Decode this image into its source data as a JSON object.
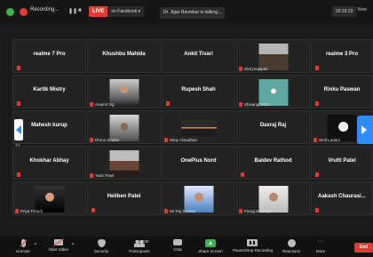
{
  "topbar": {
    "recording_label": "Recording...",
    "live_badge": "LIVE",
    "live_target": "on Facebook ▾",
    "talking": "Dr. Jigar Ravrekar is talking...",
    "timer": "00:16:23",
    "view": "View"
  },
  "tiles": [
    {
      "name": "realme 7 Pro",
      "label": ""
    },
    {
      "name": "Khushbu Mahida",
      "label": ""
    },
    {
      "name": "Ankit Tivari",
      "label": ""
    },
    {
      "name": "",
      "label": "dixit prajapati"
    },
    {
      "name": "realme 3 Pro",
      "label": ""
    },
    {
      "name": "Kartik Mistry",
      "label": ""
    },
    {
      "name": "",
      "label": "Anamit Vig"
    },
    {
      "name": "Rupesh Shah",
      "label": ""
    },
    {
      "name": "",
      "label": "Shivangi Patel"
    },
    {
      "name": "Rinku Paswan",
      "label": ""
    },
    {
      "name": "Mahesh kurup",
      "label": ""
    },
    {
      "name": "",
      "label": "Dhruv Shukla"
    },
    {
      "name": "",
      "label": "Nilay chaudhari"
    },
    {
      "name": "Daxraj Raj",
      "label": ""
    },
    {
      "name": "",
      "label": "Smit Ladani"
    },
    {
      "name": "Khokhar Abhay",
      "label": ""
    },
    {
      "name": "",
      "label": "Yash Patel"
    },
    {
      "name": "OnePlus Nord",
      "label": ""
    },
    {
      "name": "Baldev Rathod",
      "label": ""
    },
    {
      "name": "Vrutti Patel",
      "label": ""
    },
    {
      "name": "",
      "label": "Priya Trivedi"
    },
    {
      "name": "Heliben Patel",
      "label": ""
    },
    {
      "name": "",
      "label": "Mr Raj D Patel"
    },
    {
      "name": "",
      "label": "Parag Babariya"
    },
    {
      "name": "Aakash Chaurasi...",
      "label": ""
    }
  ],
  "nav": {
    "page": "1/4"
  },
  "toolbar": {
    "unmute": "Unmute",
    "start_video": "Start Video",
    "security": "Security",
    "participants": "Participants",
    "participants_count": "100",
    "chat": "Chat",
    "share": "Share Screen",
    "recording": "Pause/Stop Recording",
    "reactions": "Reactions",
    "more": "More",
    "end": "End"
  }
}
